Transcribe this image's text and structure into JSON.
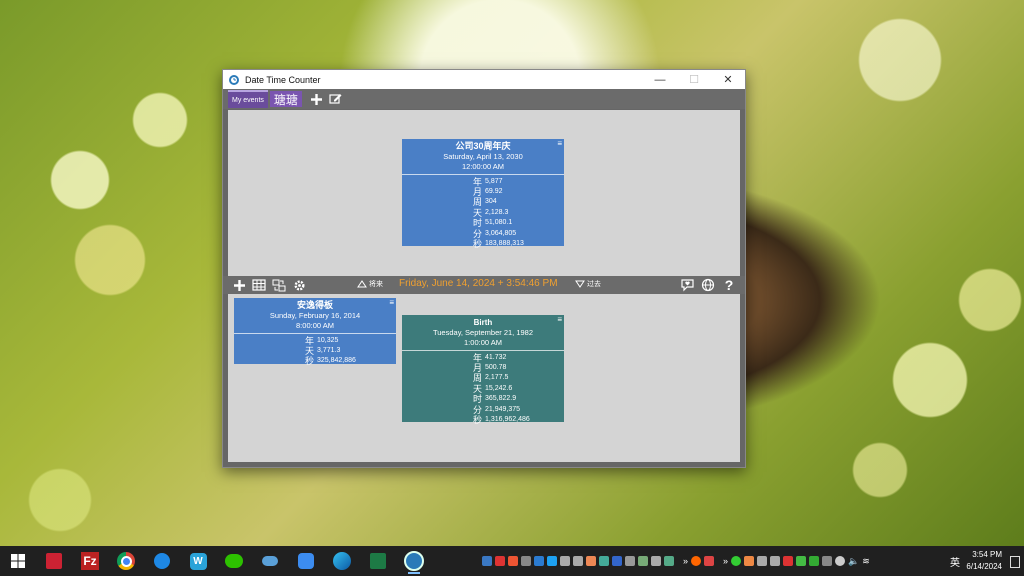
{
  "window": {
    "title": "Date Time Counter",
    "controls": {
      "minimize": "—",
      "maximize": "☐",
      "close": "✕"
    }
  },
  "tabs": [
    {
      "label": "My events",
      "active": true
    },
    {
      "label": "瑭瑭",
      "active": false
    }
  ],
  "midbar": {
    "future_label": "将来",
    "current_datetime": "Friday, June 14, 2024 + 3:54:46 PM",
    "past_label": "过去"
  },
  "future_events": [
    {
      "name": "公司30周年庆",
      "date": "Saturday, April 13, 2030",
      "time": "12:00:00 AM",
      "color": "#4a7fc6",
      "rows": [
        {
          "unit": "年",
          "value": "5,877"
        },
        {
          "unit": "月",
          "value": "69.92"
        },
        {
          "unit": "周",
          "value": "304"
        },
        {
          "unit": "天",
          "value": "2,128.3"
        },
        {
          "unit": "时",
          "value": "51,080.1"
        },
        {
          "unit": "分",
          "value": "3,064,805"
        },
        {
          "unit": "秒",
          "value": "183,888,313"
        }
      ]
    }
  ],
  "past_events": [
    {
      "name": "安逸得板",
      "date": "Sunday, February 16, 2014",
      "time": "8:00:00 AM",
      "color": "#4a7fc6",
      "rows": [
        {
          "unit": "年",
          "value": "10,325"
        },
        {
          "unit": "天",
          "value": "3,771.3"
        },
        {
          "unit": "秒",
          "value": "325,842,886"
        }
      ]
    },
    {
      "name": "Birth",
      "date": "Tuesday, September 21, 1982",
      "time": "1:00:00 AM",
      "color": "#3d7b7b",
      "rows": [
        {
          "unit": "年",
          "value": "41.732"
        },
        {
          "unit": "月",
          "value": "500.78"
        },
        {
          "unit": "周",
          "value": "2,177.5"
        },
        {
          "unit": "天",
          "value": "15,242.6"
        },
        {
          "unit": "时",
          "value": "365,822.9"
        },
        {
          "unit": "分",
          "value": "21,949,375"
        },
        {
          "unit": "秒",
          "value": "1,316,962,486"
        }
      ]
    }
  ],
  "taskbar": {
    "clock_time": "3:54 PM",
    "clock_date": "6/14/2024",
    "ime": "英"
  }
}
